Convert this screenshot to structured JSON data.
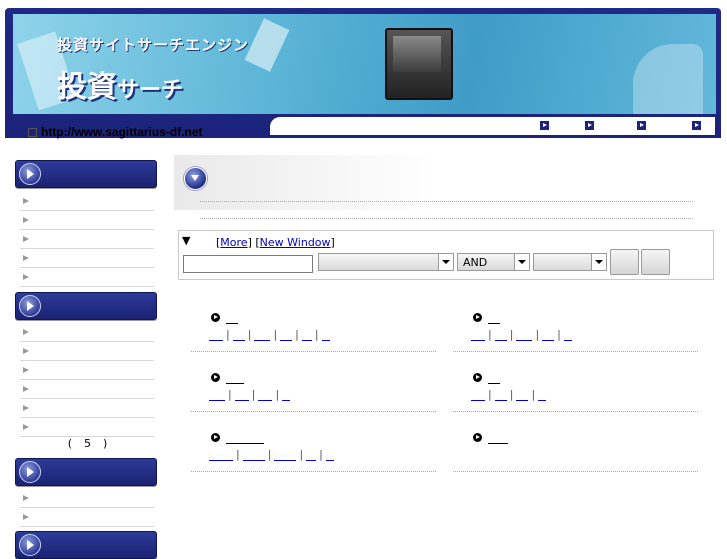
{
  "header": {
    "subtitle": "投資サイトサーチエンジン",
    "title_main": "投資",
    "title_small": "サーチ",
    "url": "http://www.sagittarius-df.net",
    "nav_count": 4
  },
  "sidebar": {
    "box1_items": 5,
    "box2_items": 6,
    "box3_items": 2,
    "count_open": "(",
    "count_value": "5",
    "count_close": ")"
  },
  "search": {
    "toggle": "▼",
    "more_label": "More",
    "new_window_label": "New Window",
    "input_value": "",
    "category_select": "",
    "mode_select": "AND",
    "extra_select": ""
  },
  "categories": [
    {
      "links": 5
    },
    {
      "links": 4
    },
    {
      "links": 3
    },
    {
      "links": 3
    },
    {
      "links": 4
    },
    {
      "links": 0
    }
  ],
  "colors": {
    "header_dark": "#1b237a",
    "banner_light": "#5fb7d8",
    "link": "#0000cc"
  }
}
